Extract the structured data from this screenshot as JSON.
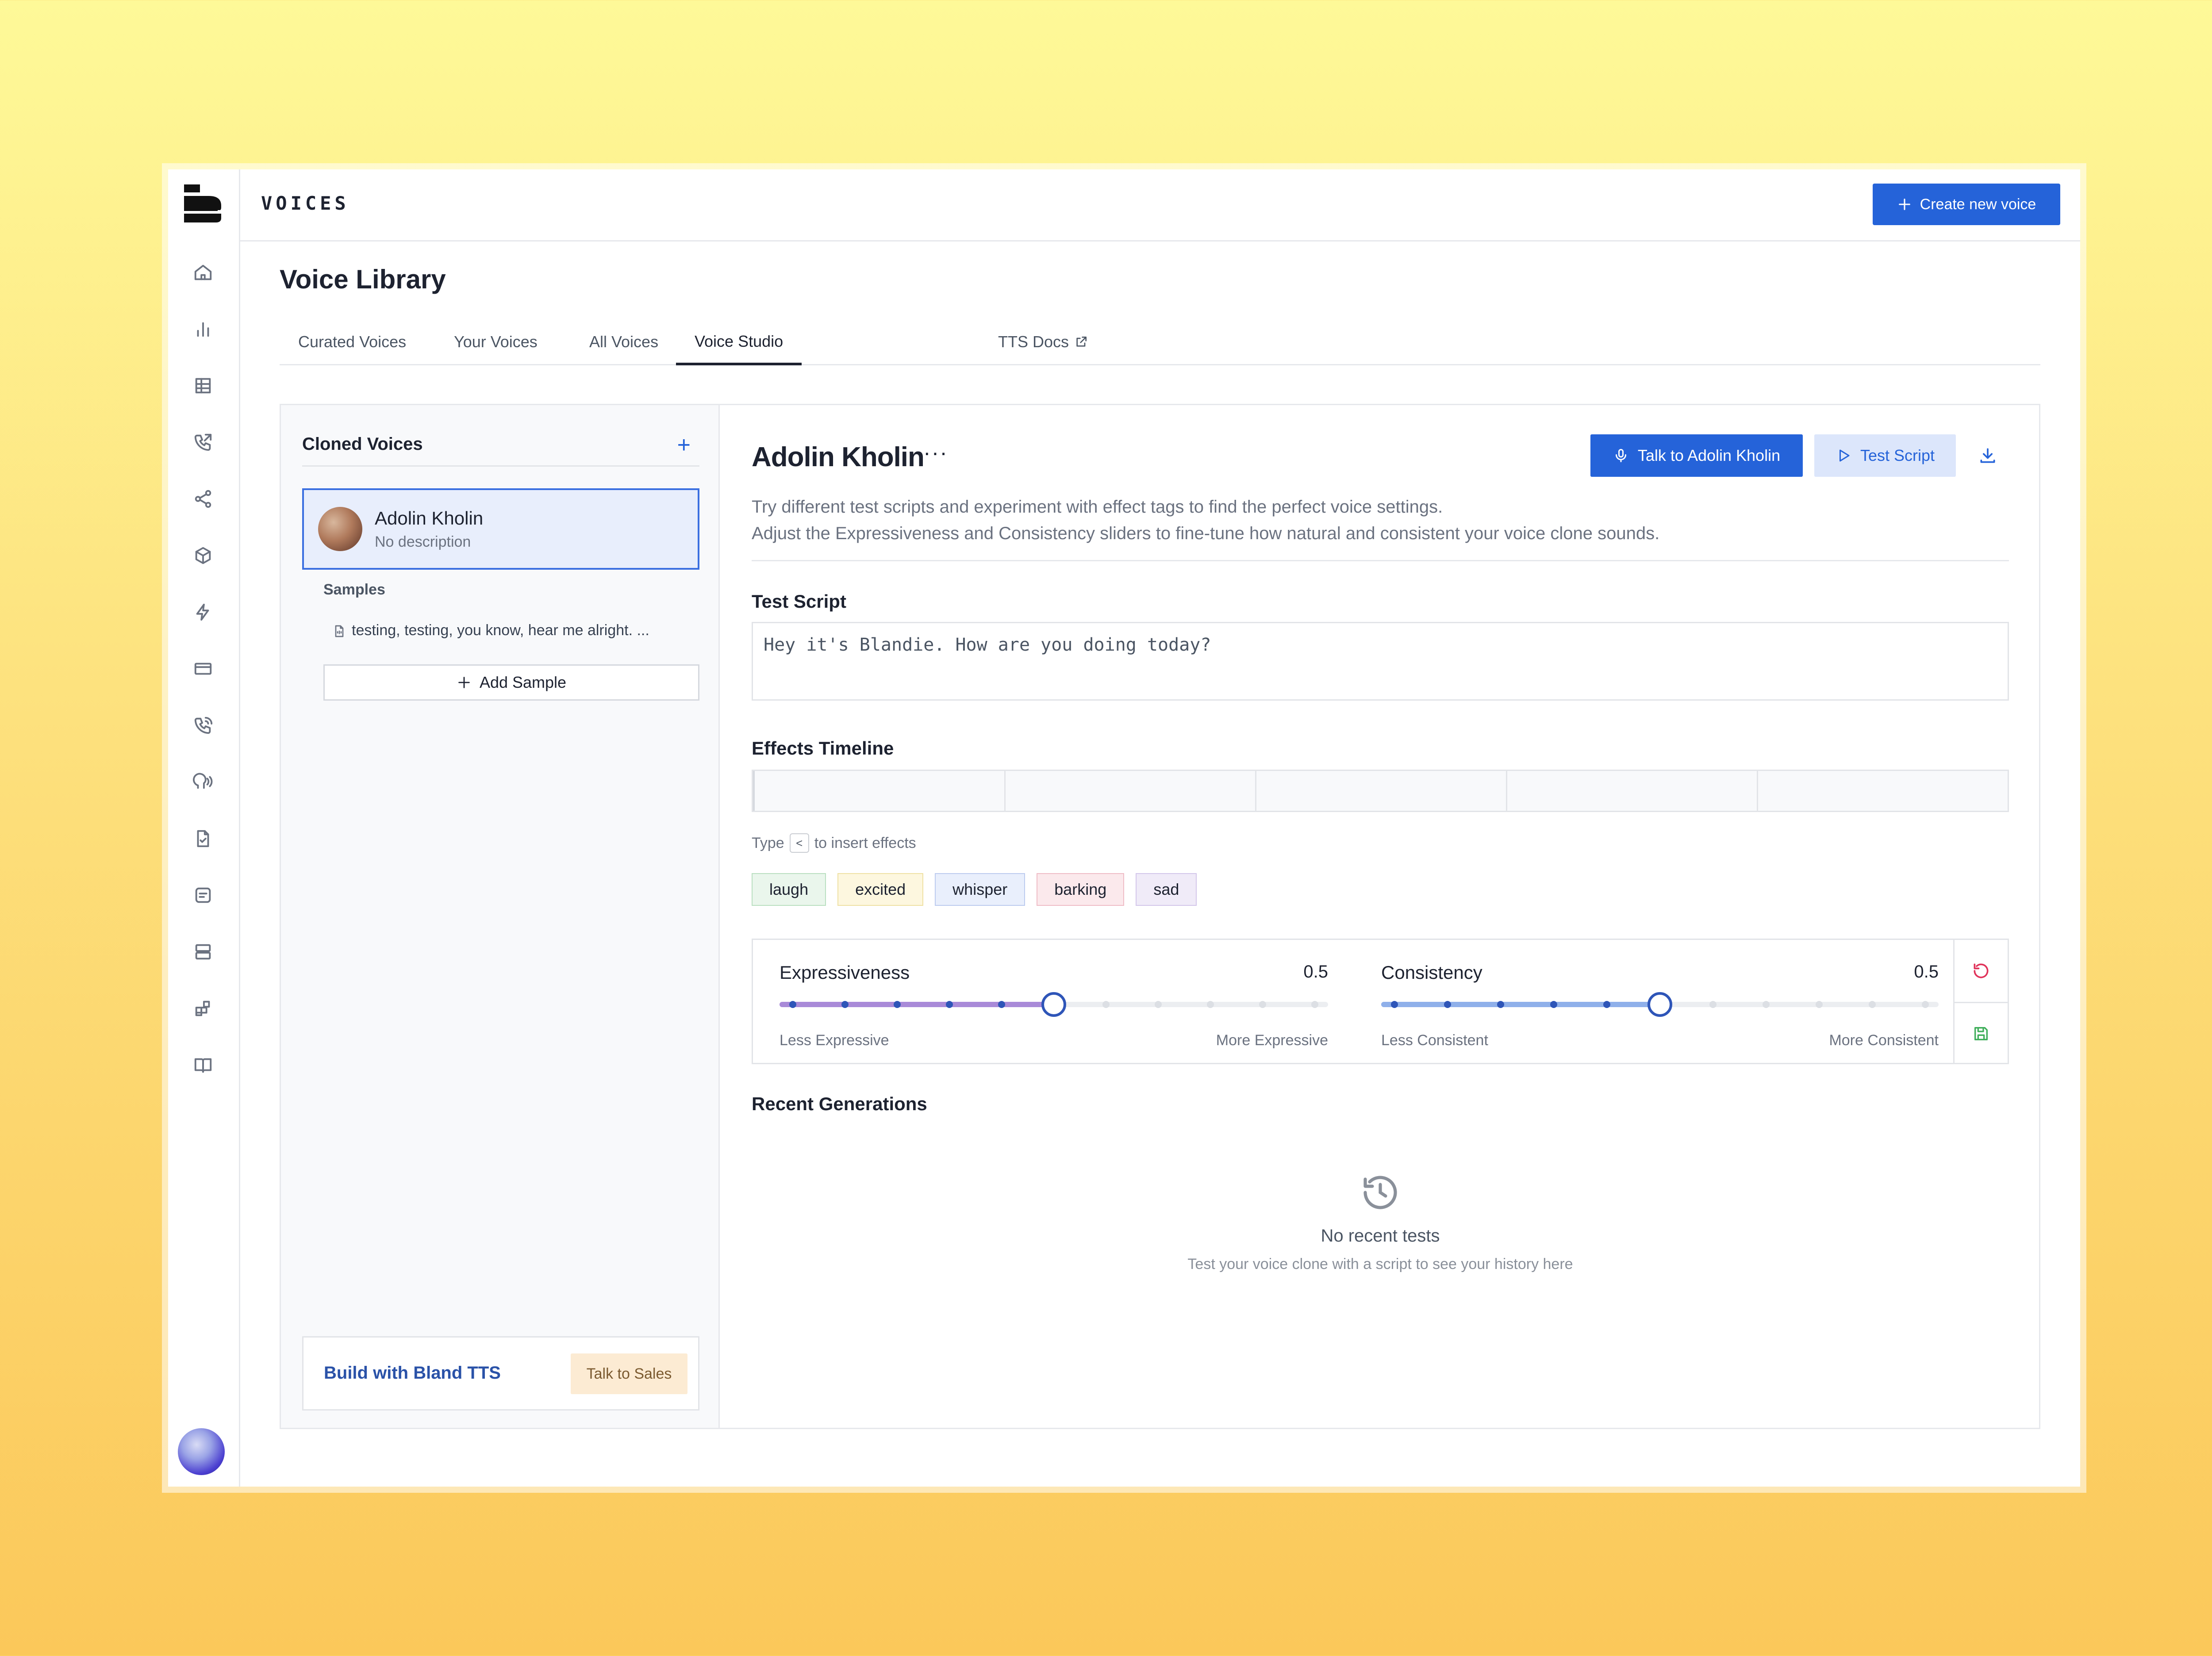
{
  "app": {
    "section_title": "VOICES",
    "create_button": "Create new voice"
  },
  "page": {
    "title": "Voice Library"
  },
  "tabs": [
    {
      "label": "Curated Voices"
    },
    {
      "label": "Your Voices"
    },
    {
      "label": "All Voices"
    },
    {
      "label": "Voice Studio",
      "active": true
    },
    {
      "label": "TTS Docs",
      "external": true
    }
  ],
  "sidebar": {
    "icons": [
      "home-icon",
      "bar-chart-icon",
      "table-icon",
      "phone-outgoing-icon",
      "share-nodes-icon",
      "box-icon",
      "lightning-icon",
      "card-icon",
      "phone-call-icon",
      "voice-icon",
      "file-check-icon",
      "message-icon",
      "server-icon",
      "widgets-icon",
      "book-icon"
    ]
  },
  "cloned": {
    "title": "Cloned Voices",
    "voice_name": "Adolin Kholin",
    "voice_desc": "No description",
    "samples_label": "Samples",
    "sample_text": "testing, testing, you know, hear me alright. ...",
    "add_sample": "Add Sample",
    "build_text": "Build with Bland TTS",
    "sales_button": "Talk to Sales"
  },
  "studio": {
    "name": "Adolin Kholin",
    "more": "···",
    "talk_button": "Talk to Adolin Kholin",
    "test_button": "Test Script",
    "desc_line1": "Try different test scripts and experiment with effect tags to find the perfect voice settings.",
    "desc_line2": "Adjust the Expressiveness and Consistency sliders to fine-tune how natural and consistent your voice clone sounds.",
    "script_title": "Test Script",
    "script_placeholder": "Hey it's Blandie. How are you doing today?",
    "timeline_title": "Effects Timeline",
    "hint_prefix": "Type",
    "hint_key": "<",
    "hint_suffix": "to insert effects",
    "tags": [
      {
        "label": "laugh",
        "bg": "#eaf6ec",
        "border": "#b9dfc0"
      },
      {
        "label": "excited",
        "bg": "#fdf7df",
        "border": "#efe1a3"
      },
      {
        "label": "whisper",
        "bg": "#e9effc",
        "border": "#bccbef"
      },
      {
        "label": "barking",
        "bg": "#fbe9ec",
        "border": "#efbcc6"
      },
      {
        "label": "sad",
        "bg": "#f0ebf8",
        "border": "#d3c6ea"
      }
    ],
    "expressiveness": {
      "label": "Expressiveness",
      "value_text": "0.5",
      "value": 0.5,
      "min_label": "Less Expressive",
      "max_label": "More Expressive",
      "color": "#a98ad8"
    },
    "consistency": {
      "label": "Consistency",
      "value_text": "0.5",
      "value": 0.5,
      "min_label": "Less Consistent",
      "max_label": "More Consistent",
      "color": "#8fb0ea"
    },
    "recent_title": "Recent Generations",
    "empty_title": "No recent tests",
    "empty_sub": "Test your voice clone with a script to see your history here"
  }
}
